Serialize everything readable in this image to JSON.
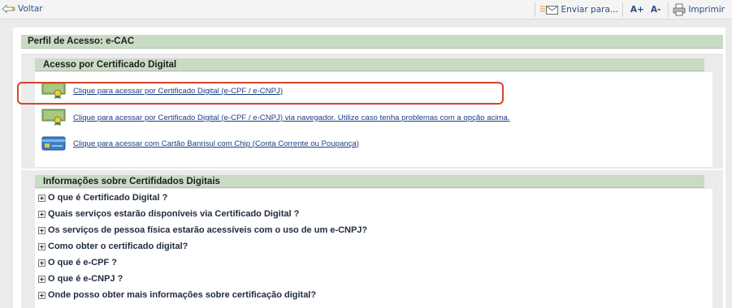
{
  "topbar": {
    "back_label": "Voltar",
    "send_label": "Enviar para...",
    "font_increase": "A+",
    "font_decrease": "A-",
    "print_label": "Imprimir"
  },
  "profile": {
    "title": "Perfil de Acesso: e-CAC"
  },
  "cert_section": {
    "title": "Acesso por Certificado Digital",
    "options": [
      {
        "label": "Clique para acessar por Certificado Digital (e-CPF / e-CNPJ)",
        "icon": "certificate-icon"
      },
      {
        "label": "Clique para acessar por Certificado Digital (e-CPF / e-CNPJ) via navegador. Utilize caso tenha problemas com a opção acima.",
        "icon": "certificate-icon"
      },
      {
        "label": "Clique para acessar com Cartão Banrisul com Chip (Conta Corrente ou Poupança)",
        "icon": "bank-card-icon"
      }
    ]
  },
  "info_section": {
    "title": "Informações sobre Certifidados Digitais",
    "items": [
      "O que é Certificado Digital ?",
      "Quais serviços estarão disponíveis via Certificado Digital ?",
      "Os serviços de pessoa física estarão acessíveis com o uso de um e-CNPJ?",
      "Como obter o certificado digital?",
      "O que é e-CPF ?",
      "O que é e-CNPJ ?",
      "Onde posso obter mais informações sobre certificação digital?"
    ]
  },
  "colors": {
    "header_green": "#c9dbc5",
    "link_blue": "#1a3d85",
    "highlight_red": "#d6452a",
    "page_gray": "#ebebeb"
  }
}
